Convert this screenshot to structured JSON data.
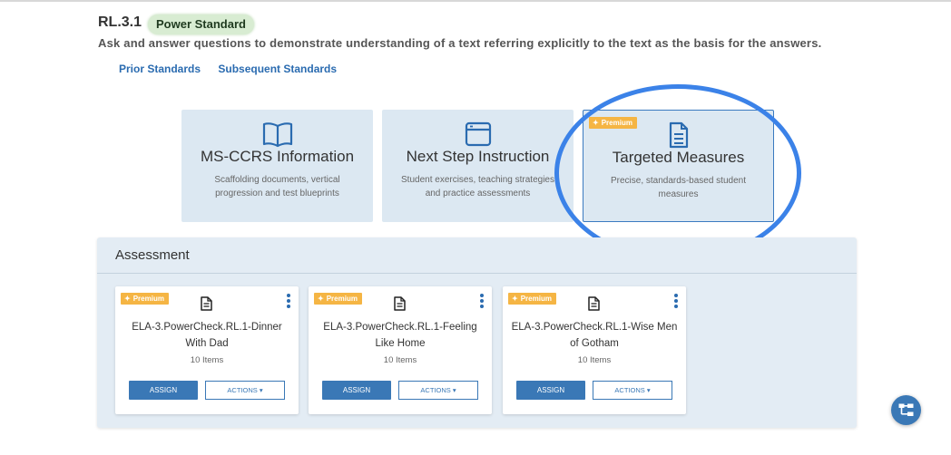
{
  "standard": {
    "code": "RL.3.1",
    "badge": "Power Standard",
    "description": "Ask and answer questions to demonstrate understanding of a text referring explicitly to the text as the basis for the answers."
  },
  "links": {
    "prior": "Prior Standards",
    "subsequent": "Subsequent Standards"
  },
  "features": [
    {
      "icon": "book-open-icon",
      "title": "MS-CCRS Information",
      "description": "Scaffolding documents, vertical progression and test blueprints",
      "premium": ""
    },
    {
      "icon": "browser-window-icon",
      "title": "Next Step Instruction",
      "description": "Student exercises, teaching strategies and practice assessments",
      "premium": ""
    },
    {
      "icon": "document-icon",
      "title": "Targeted Measures",
      "description": "Precise, standards-based student measures",
      "premium": "Premium"
    }
  ],
  "assessment": {
    "title": "Assessment",
    "cards": [
      {
        "premium": "Premium",
        "title": "ELA-3.PowerCheck.RL.1-Dinner With Dad",
        "count": "10 Items",
        "assign": "ASSIGN",
        "actions": "ACTIONS ▾"
      },
      {
        "premium": "Premium",
        "title": "ELA-3.PowerCheck.RL.1-Feeling Like Home",
        "count": "10 Items",
        "assign": "ASSIGN",
        "actions": "ACTIONS ▾"
      },
      {
        "premium": "Premium",
        "title": "ELA-3.PowerCheck.RL.1-Wise Men of Gotham",
        "count": "10 Items",
        "assign": "ASSIGN",
        "actions": "ACTIONS ▾"
      }
    ]
  },
  "colors": {
    "accent": "#3a78b6",
    "premium": "#f5b544",
    "badge_bg": "#d8ecd2",
    "highlight_circle": "#3b82e8"
  },
  "fab": {
    "icon": "sitemap-icon"
  }
}
